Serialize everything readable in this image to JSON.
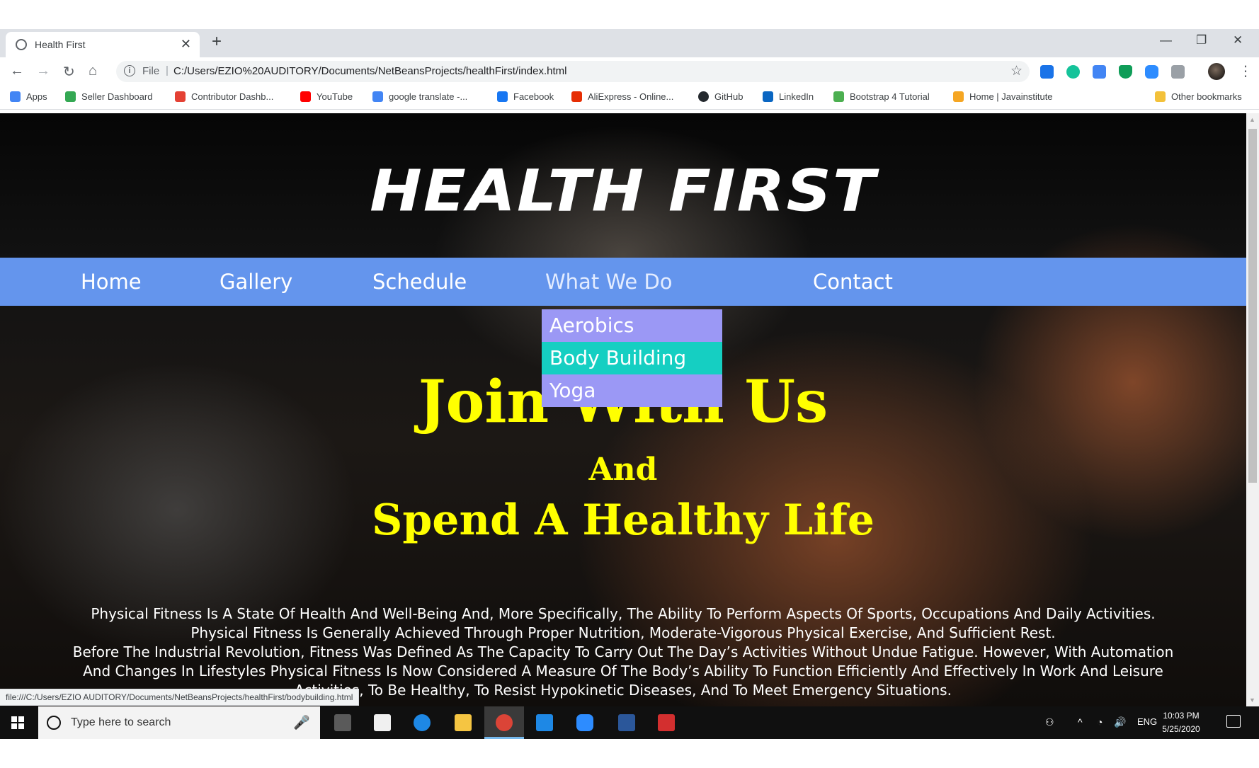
{
  "browser": {
    "tab_title": "Health First",
    "tab_close": "✕",
    "new_tab": "+",
    "window_controls": {
      "minimize": "—",
      "restore": "❐",
      "close": "✕"
    },
    "nav": {
      "back": "←",
      "forward": "→",
      "reload": "↻",
      "home": "⌂"
    },
    "address": {
      "info": "i",
      "scheme": "File",
      "separator": "|",
      "url": "C:/Users/EZIO%20AUDITORY/Documents/NetBeansProjects/healthFirst/index.html",
      "star": "☆"
    },
    "menu": "⋮",
    "extension_colors": [
      "#1a73e8",
      "#15c39a",
      "#4285f4",
      "#0f9d58",
      "#2d8cff",
      "#9aa0a6"
    ]
  },
  "bookmarks": [
    {
      "label": "Apps",
      "icon": "apps-grid-icon",
      "color": "#4285f4"
    },
    {
      "label": "Seller Dashboard",
      "icon": "seller-icon",
      "color": "#34a853"
    },
    {
      "label": "Contributor Dashb...",
      "icon": "contributor-icon",
      "color": "#e44134"
    },
    {
      "label": "YouTube",
      "icon": "youtube-icon",
      "color": "#ff0000"
    },
    {
      "label": "google translate -...",
      "icon": "google-icon",
      "color": "#4285f4"
    },
    {
      "label": "Facebook",
      "icon": "facebook-icon",
      "color": "#1877f2"
    },
    {
      "label": "AliExpress - Online...",
      "icon": "aliexpress-icon",
      "color": "#e62e04"
    },
    {
      "label": "GitHub",
      "icon": "github-icon",
      "color": "#24292e"
    },
    {
      "label": "LinkedIn",
      "icon": "linkedin-icon",
      "color": "#0a66c2"
    },
    {
      "label": "Bootstrap 4 Tutorial",
      "icon": "w3schools-icon",
      "color": "#4caf50"
    },
    {
      "label": "Home | Javainstitute",
      "icon": "javainstitute-icon",
      "color": "#f5a623"
    },
    {
      "label": "Other bookmarks",
      "icon": "folder-icon",
      "color": "#f3c13a"
    }
  ],
  "page": {
    "brand": "HEALTH FIRST",
    "nav": {
      "home": "Home",
      "gallery": "Gallery",
      "schedule": "Schedule",
      "what_we_do": "What We Do",
      "contact": "Contact"
    },
    "dropdown": {
      "aerobics": "Aerobics",
      "body_building": "Body Building",
      "yoga": "Yoga"
    },
    "hero": {
      "line1": "Join With Us",
      "line2": "And",
      "line3": "Spend A Healthy Life"
    },
    "description": {
      "p1": "Physical Fitness Is A State Of Health And Well-Being And, More Specifically, The Ability To Perform Aspects Of Sports, Occupations And Daily Activities. Physical Fitness Is Generally Achieved Through Proper Nutrition, Moderate-Vigorous Physical Exercise, And Sufficient Rest.",
      "p2": "Before The Industrial Revolution, Fitness Was Defined As The Capacity To Carry Out The Day’s Activities Without Undue Fatigue. However, With Automation And Changes In Lifestyles Physical Fitness Is Now Considered A Measure Of The Body’s Ability To Function Efficiently And Effectively In Work And Leisure Activities, To Be Healthy, To Resist Hypokinetic Diseases, And To Meet Emergency Situations."
    },
    "colors": {
      "navbar": "#6495ed",
      "hero_text": "#ffff00",
      "dropdown_item": "#9b98f5",
      "dropdown_hover": "#15cfc2"
    }
  },
  "status_url": "file:///C:/Users/EZIO AUDITORY/Documents/NetBeansProjects/healthFirst/bodybuilding.html",
  "taskbar": {
    "search_placeholder": "Type here to search",
    "mic": "🎤",
    "apps": [
      {
        "name": "task-view-icon",
        "color": "#5a5a5a"
      },
      {
        "name": "store-icon",
        "color": "#f0f0f0"
      },
      {
        "name": "edge-icon",
        "color": "#1e88e5"
      },
      {
        "name": "file-explorer-icon",
        "color": "#f5c542"
      },
      {
        "name": "chrome-icon",
        "color": "#db4437"
      },
      {
        "name": "mail-icon",
        "color": "#1e88e5"
      },
      {
        "name": "zoom-icon",
        "color": "#2d8cff"
      },
      {
        "name": "word-icon",
        "color": "#2b579a"
      },
      {
        "name": "acrobat-icon",
        "color": "#d32f2f"
      }
    ],
    "tray": {
      "people": "⚇",
      "chevron": "^",
      "wifi": "◔",
      "volume": "🔊",
      "language": "ENG"
    },
    "clock": {
      "time": "10:03 PM",
      "date": "5/25/2020"
    }
  }
}
